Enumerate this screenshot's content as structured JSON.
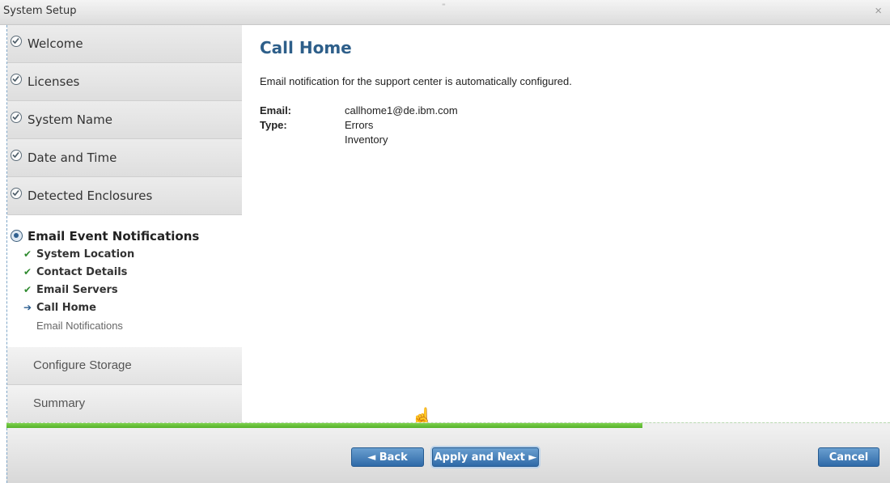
{
  "window": {
    "title": "System Setup",
    "close_glyph": "×"
  },
  "sidebar": {
    "completed_steps": [
      {
        "label": "Welcome"
      },
      {
        "label": "Licenses"
      },
      {
        "label": "System Name"
      },
      {
        "label": "Date and Time"
      },
      {
        "label": "Detected Enclosures"
      }
    ],
    "active_step": {
      "label": "Email Event Notifications",
      "substeps": [
        {
          "label": "System Location",
          "status": "done"
        },
        {
          "label": "Contact Details",
          "status": "done"
        },
        {
          "label": "Email Servers",
          "status": "done"
        },
        {
          "label": "Call Home",
          "status": "current"
        },
        {
          "label": "Email Notifications",
          "status": "pending"
        }
      ]
    },
    "future_steps": [
      {
        "label": "Configure Storage"
      },
      {
        "label": "Summary"
      }
    ]
  },
  "main": {
    "title": "Call Home",
    "intro": "Email notification for the support center is automatically configured.",
    "email_label": "Email:",
    "email_value": "callhome1@de.ibm.com",
    "type_label": "Type:",
    "type_values": [
      "Errors",
      "Inventory"
    ]
  },
  "progress": {
    "fraction": 0.72,
    "color": "#55b12a"
  },
  "footer": {
    "back_label": "◄ Back",
    "next_label": "Apply and Next ►",
    "cancel_label": "Cancel"
  },
  "colors": {
    "accent": "#2e5f8a",
    "button": "#2f6aa8"
  },
  "icons": {
    "done": "check-circle-icon",
    "active": "radio-active-icon",
    "sub_done": "checkmark-icon",
    "sub_current": "arrow-right-icon"
  }
}
